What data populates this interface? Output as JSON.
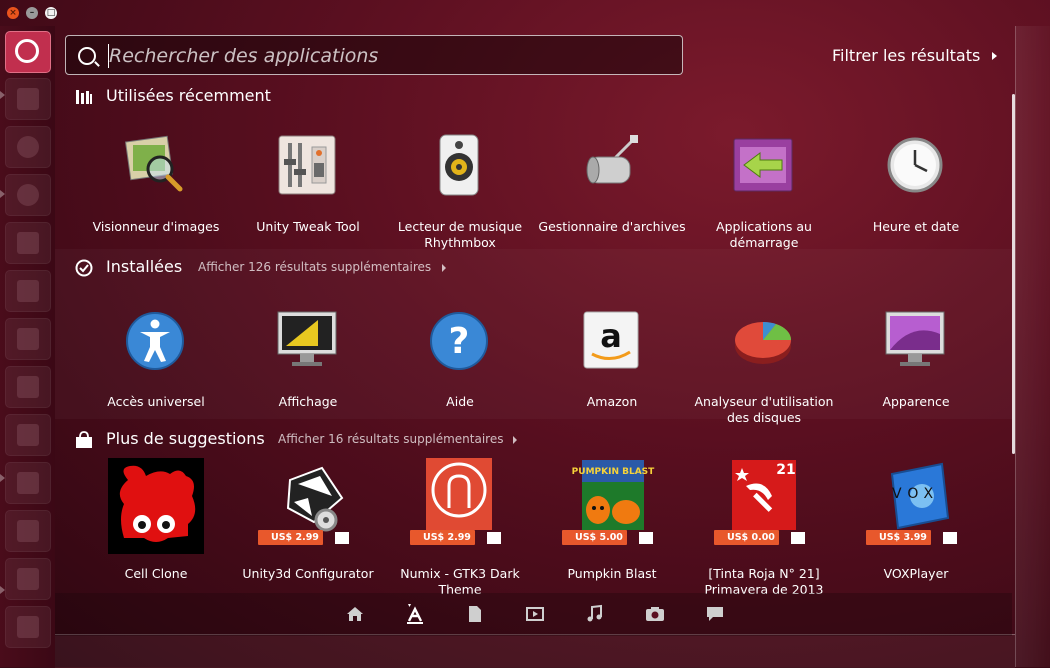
{
  "search": {
    "placeholder": "Rechercher des applications",
    "value": ""
  },
  "filter": {
    "label": "Filtrer les résultats"
  },
  "sections": [
    {
      "title": "Utilisées récemment",
      "more": "",
      "items": [
        {
          "label": "Visionneur d'images",
          "icon": "image-viewer-icon"
        },
        {
          "label": "Unity Tweak Tool",
          "icon": "tweak-tool-icon"
        },
        {
          "label": "Lecteur de musique Rhythmbox",
          "icon": "rhythmbox-icon"
        },
        {
          "label": "Gestionnaire d'archives",
          "icon": "archive-manager-icon"
        },
        {
          "label": "Applications au démarrage",
          "icon": "startup-apps-icon"
        },
        {
          "label": "Heure et date",
          "icon": "clock-icon"
        }
      ]
    },
    {
      "title": "Installées",
      "more": "Afficher 126 résultats supplémentaires",
      "items": [
        {
          "label": "Accès universel",
          "icon": "accessibility-icon"
        },
        {
          "label": "Affichage",
          "icon": "display-icon"
        },
        {
          "label": "Aide",
          "icon": "help-icon"
        },
        {
          "label": "Amazon",
          "icon": "amazon-icon"
        },
        {
          "label": "Analyseur d'utilisation des disques",
          "icon": "disk-usage-icon"
        },
        {
          "label": "Apparence",
          "icon": "appearance-icon"
        }
      ]
    },
    {
      "title": "Plus de suggestions",
      "more": "Afficher 16 résultats supplémentaires",
      "items": [
        {
          "label": "Cell Clone",
          "icon": "cell-clone-icon",
          "price": ""
        },
        {
          "label": "Unity3d Configurator",
          "icon": "unity3d-configurator-icon",
          "price": "US$ 2.99"
        },
        {
          "label": "Numix - GTK3 Dark Theme",
          "icon": "numix-icon",
          "price": "US$ 2.99"
        },
        {
          "label": "Pumpkin Blast",
          "icon": "pumpkin-blast-icon",
          "price": "US$ 5.00",
          "art": "PUMPKIN BLAST"
        },
        {
          "label": "[Tinta Roja N° 21] Primavera de 2013",
          "icon": "tinta-roja-icon",
          "price": "US$ 0.00",
          "badge": "21"
        },
        {
          "label": "VOXPlayer",
          "icon": "voxplayer-icon",
          "price": "US$ 3.99",
          "art": "VOX"
        }
      ]
    }
  ],
  "lenses": [
    "home-lens-icon",
    "applications-lens-icon",
    "files-lens-icon",
    "video-lens-icon",
    "music-lens-icon",
    "photo-lens-icon",
    "social-lens-icon"
  ],
  "colors": {
    "accent": "#c12f4e",
    "price": "#e8582c"
  }
}
